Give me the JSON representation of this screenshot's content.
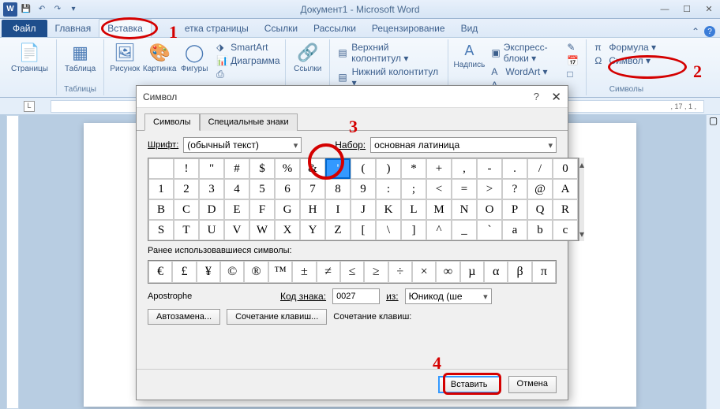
{
  "title": "Документ1 - Microsoft Word",
  "tabs": {
    "file": "Файл",
    "home": "Главная",
    "insert": "Вставка",
    "layout": "етка страницы",
    "links": "Ссылки",
    "mail": "Рассылки",
    "review": "Рецензирование",
    "view": "Вид"
  },
  "ribbon": {
    "pages": {
      "label": "Страницы",
      "btn": "Страницы"
    },
    "tables": {
      "label": "Таблицы",
      "btn": "Таблица"
    },
    "illustrations": {
      "label": "",
      "pic": "Рисунок",
      "clip": "Картинка",
      "shapes": "Фигуры",
      "smartart": "SmartArt",
      "chart": "Диаграмма",
      "screenshot": ""
    },
    "links": {
      "label": "Ссылки",
      "btn": "Ссылки"
    },
    "header": {
      "top": "Верхний колонтитул ▾",
      "bottom": "Нижний колонтитул ▾",
      "label": ""
    },
    "text": {
      "textbox": "Надпись",
      "express": "Экспресс-блоки ▾",
      "wordart": "WordArt ▾",
      "label": ""
    },
    "symbols": {
      "formula": "Формула ▾",
      "symbol": "Символ ▾",
      "label": "Символы"
    }
  },
  "ruler_marks": ", 17 , 1 ,",
  "dialog": {
    "title": "Символ",
    "tab_symbols": "Символы",
    "tab_special": "Специальные знаки",
    "font_label": "Шрифт:",
    "font_value": "(обычный текст)",
    "set_label": "Набор:",
    "set_value": "основная латиница",
    "grid": [
      [
        " ",
        "!",
        "\"",
        "#",
        "$",
        "%",
        "&",
        "'",
        "(",
        ")",
        "*",
        "+",
        ",",
        "-",
        ".",
        "/",
        "0"
      ],
      [
        "1",
        "2",
        "3",
        "4",
        "5",
        "6",
        "7",
        "8",
        "9",
        ":",
        ";",
        "<",
        "=",
        ">",
        "?",
        "@",
        "A"
      ],
      [
        "B",
        "C",
        "D",
        "E",
        "F",
        "G",
        "H",
        "I",
        "J",
        "K",
        "L",
        "M",
        "N",
        "O",
        "P",
        "Q",
        "R"
      ],
      [
        "S",
        "T",
        "U",
        "V",
        "W",
        "X",
        "Y",
        "Z",
        "[",
        "\\",
        "]",
        "^",
        "_",
        "`",
        "a",
        "b",
        "c"
      ]
    ],
    "selected_row": 0,
    "selected_col": 7,
    "recent_label": "Ранее использовавшиеся символы:",
    "recent": [
      "€",
      "£",
      "¥",
      "©",
      "®",
      "™",
      "±",
      "≠",
      "≤",
      "≥",
      "÷",
      "×",
      "∞",
      "µ",
      "α",
      "β",
      "π"
    ],
    "char_name": "Apostrophe",
    "code_label": "Код знака:",
    "code_value": "0027",
    "from_label": "из:",
    "from_value": "Юникод (ше",
    "autocorrect": "Автозамена...",
    "shortcut": "Сочетание клавиш...",
    "shortcut_label": "Сочетание клавиш:",
    "insert": "Вставить",
    "cancel": "Отмена"
  },
  "annotations": {
    "n1": "1",
    "n2": "2",
    "n3": "3",
    "n4": "4"
  }
}
